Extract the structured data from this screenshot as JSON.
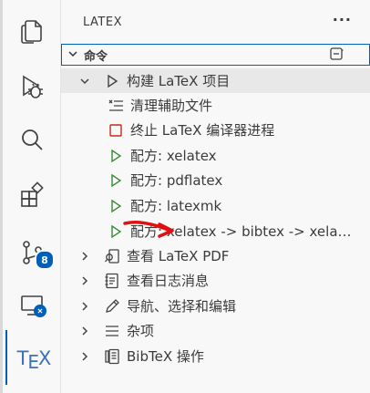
{
  "activity": {
    "scm_badge": "8",
    "tex_label_t": "T",
    "tex_label_e": "E",
    "tex_label_x": "X"
  },
  "sidebar": {
    "title": "LATEX",
    "more": "···",
    "section_label": "命令",
    "items": [
      {
        "label": "构建 LaTeX 项目",
        "icon": "play-icon"
      },
      {
        "label": "清理辅助文件",
        "icon": "clean-list-icon"
      },
      {
        "label": "终止 LaTeX 编译器进程",
        "icon": "stop-icon"
      },
      {
        "label": "配方: xelatex",
        "icon": "play-green-icon"
      },
      {
        "label": "配方: pdflatex",
        "icon": "play-green-icon"
      },
      {
        "label": "配方: latexmk",
        "icon": "play-green-icon"
      },
      {
        "label": "配方: xelatex -> bibtex -> xelat...",
        "icon": "play-green-icon"
      },
      {
        "label": "查看 LaTeX PDF",
        "icon": "preview-icon"
      },
      {
        "label": "查看日志消息",
        "icon": "log-icon"
      },
      {
        "label": "导航、选择和编辑",
        "icon": "pencil-icon"
      },
      {
        "label": "杂项",
        "icon": "menu-icon"
      },
      {
        "label": "BibTeX 操作",
        "icon": "bibtex-icon"
      }
    ]
  },
  "colors": {
    "accent": "#005fb8",
    "green_play": "#388a34",
    "red_stop": "#c42b1c",
    "annotation_arrow": "#e01010"
  }
}
